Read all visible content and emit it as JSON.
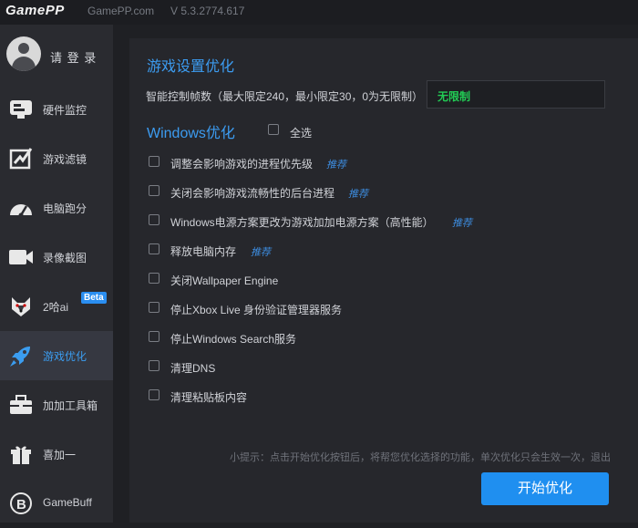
{
  "titlebar": {
    "logo": "GamePP",
    "site": "GamePP.com",
    "version": "V 5.3.2774.617"
  },
  "sidebar": {
    "login_label": "请 登 录",
    "items": [
      {
        "label": "硬件监控",
        "icon": "hardware-monitor-icon"
      },
      {
        "label": "游戏滤镜",
        "icon": "game-filter-icon"
      },
      {
        "label": "电脑跑分",
        "icon": "benchmark-gauge-icon"
      },
      {
        "label": "录像截图",
        "icon": "video-camera-icon"
      },
      {
        "label": "2哈ai",
        "icon": "husky-icon",
        "badge": "Beta"
      },
      {
        "label": "游戏优化",
        "icon": "rocket-icon",
        "active": true
      },
      {
        "label": "加加工具箱",
        "icon": "toolbox-icon"
      },
      {
        "label": "喜加一",
        "icon": "gift-icon"
      },
      {
        "label": "GameBuff",
        "icon": "gamebuff-icon"
      }
    ]
  },
  "main": {
    "game_settings_title": "游戏设置优化",
    "fps_label": "智能控制帧数（最大限定240，最小限定30，0为无限制）",
    "fps_value": "无限制",
    "windows_title": "Windows优化",
    "select_all_label": "全选",
    "options": [
      {
        "label": "调整会影响游戏的进程优先级",
        "recommended": "推荐"
      },
      {
        "label": "关闭会影响游戏流畅性的后台进程",
        "recommended": "推荐"
      },
      {
        "label": "Windows电源方案更改为游戏加加电源方案（高性能）",
        "recommended": "推荐"
      },
      {
        "label": "释放电脑内存",
        "recommended": "推荐"
      },
      {
        "label": "关闭Wallpaper Engine"
      },
      {
        "label": "停止Xbox Live 身份验证管理器服务"
      },
      {
        "label": "停止Windows Search服务"
      },
      {
        "label": "清理DNS"
      },
      {
        "label": "清理粘贴板内容"
      }
    ],
    "hint": "小提示：点击开始优化按钮后，将帮您优化选择的功能，单次优化只会生效一次，退出",
    "start_button": "开始优化"
  },
  "colors": {
    "accent": "#1f8ff0",
    "active_text": "#3b9df0",
    "fps_value": "#22cc55"
  }
}
